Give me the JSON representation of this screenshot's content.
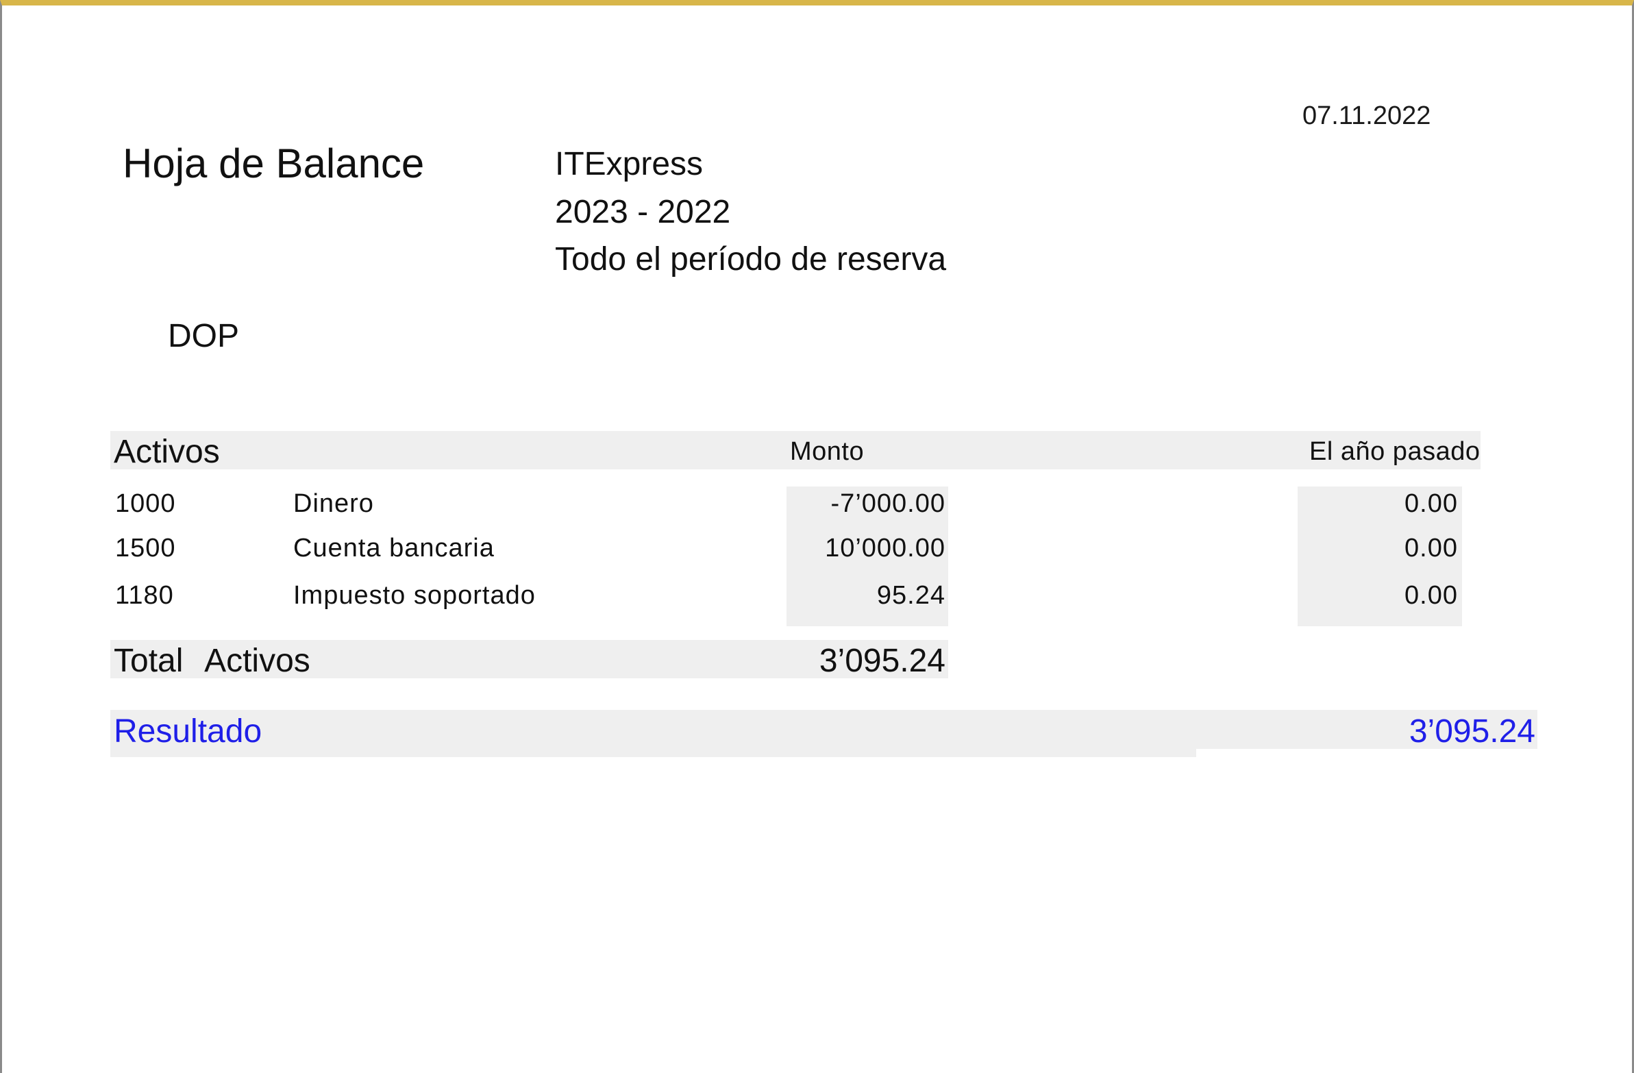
{
  "header": {
    "date": "07.11.2022",
    "title": "Hoja de Balance",
    "company": "ITExpress",
    "years": "2023 - 2022",
    "period": "Todo el período de reserva",
    "currency": "DOP"
  },
  "section": {
    "label": "Activos",
    "columns": {
      "amount": "Monto",
      "previous_year": "El año pasado"
    },
    "rows": [
      {
        "account": "1000",
        "description": "Dinero",
        "amount": "-7’000.00",
        "previous": "0.00"
      },
      {
        "account": "1500",
        "description": "Cuenta bancaria",
        "amount": "10’000.00",
        "previous": "0.00"
      },
      {
        "account": "1180",
        "description": "Impuesto soportado",
        "amount": "95.24",
        "previous": "0.00"
      }
    ],
    "total_label": "Total   Activos",
    "total_amount": "3’095.24"
  },
  "result": {
    "label": "Resultado",
    "amount": "3’095.24"
  },
  "colors": {
    "band": "#efefef",
    "result_text": "#1f1fe8",
    "top_border": "#d8b64a"
  }
}
